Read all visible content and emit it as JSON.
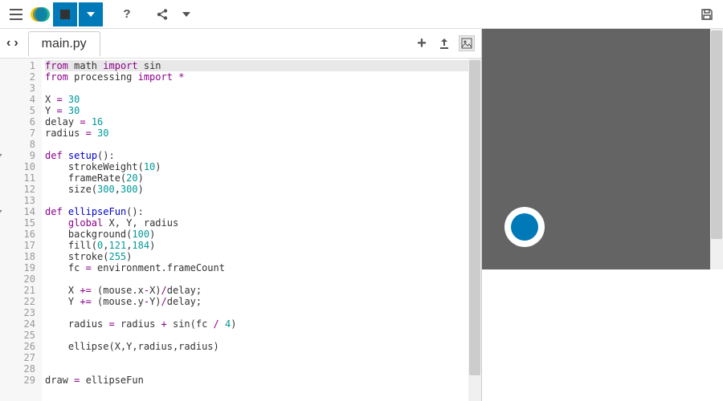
{
  "toolbar": {
    "menu": "menu",
    "help": "?",
    "share": "share",
    "dropdown": "▼",
    "save": "save"
  },
  "tabs": {
    "back": "‹",
    "forward": "›",
    "filename": "main.py",
    "add": "+",
    "upload": "⬆",
    "image": "img"
  },
  "code": {
    "lines": [
      {
        "n": 1,
        "fold": false,
        "tokens": [
          [
            "kw",
            "from"
          ],
          [
            "id",
            " math "
          ],
          [
            "kw",
            "import"
          ],
          [
            "id",
            " sin"
          ]
        ]
      },
      {
        "n": 2,
        "fold": false,
        "tokens": [
          [
            "kw",
            "from"
          ],
          [
            "id",
            " processing "
          ],
          [
            "kw",
            "import"
          ],
          [
            "id",
            " "
          ],
          [
            "op",
            "*"
          ]
        ]
      },
      {
        "n": 3,
        "fold": false,
        "tokens": []
      },
      {
        "n": 4,
        "fold": false,
        "tokens": [
          [
            "id",
            "X "
          ],
          [
            "op",
            "="
          ],
          [
            "id",
            " "
          ],
          [
            "num",
            "30"
          ]
        ]
      },
      {
        "n": 5,
        "fold": false,
        "tokens": [
          [
            "id",
            "Y "
          ],
          [
            "op",
            "="
          ],
          [
            "id",
            " "
          ],
          [
            "num",
            "30"
          ]
        ]
      },
      {
        "n": 6,
        "fold": false,
        "tokens": [
          [
            "id",
            "delay "
          ],
          [
            "op",
            "="
          ],
          [
            "id",
            " "
          ],
          [
            "num",
            "16"
          ]
        ]
      },
      {
        "n": 7,
        "fold": false,
        "tokens": [
          [
            "id",
            "radius "
          ],
          [
            "op",
            "="
          ],
          [
            "id",
            " "
          ],
          [
            "num",
            "30"
          ]
        ]
      },
      {
        "n": 8,
        "fold": false,
        "tokens": []
      },
      {
        "n": 9,
        "fold": true,
        "tokens": [
          [
            "kw",
            "def"
          ],
          [
            "id",
            " "
          ],
          [
            "fn",
            "setup"
          ],
          [
            "id",
            "():"
          ]
        ]
      },
      {
        "n": 10,
        "fold": false,
        "tokens": [
          [
            "id",
            "    strokeWeight("
          ],
          [
            "num",
            "10"
          ],
          [
            "id",
            ")"
          ]
        ]
      },
      {
        "n": 11,
        "fold": false,
        "tokens": [
          [
            "id",
            "    frameRate("
          ],
          [
            "num",
            "20"
          ],
          [
            "id",
            ")"
          ]
        ]
      },
      {
        "n": 12,
        "fold": false,
        "tokens": [
          [
            "id",
            "    size("
          ],
          [
            "num",
            "300"
          ],
          [
            "id",
            ","
          ],
          [
            "num",
            "300"
          ],
          [
            "id",
            ")"
          ]
        ]
      },
      {
        "n": 13,
        "fold": false,
        "tokens": []
      },
      {
        "n": 14,
        "fold": true,
        "tokens": [
          [
            "kw",
            "def"
          ],
          [
            "id",
            " "
          ],
          [
            "fn",
            "ellipseFun"
          ],
          [
            "id",
            "():"
          ]
        ]
      },
      {
        "n": 15,
        "fold": false,
        "tokens": [
          [
            "id",
            "    "
          ],
          [
            "kw",
            "global"
          ],
          [
            "id",
            " X, Y, radius"
          ]
        ]
      },
      {
        "n": 16,
        "fold": false,
        "tokens": [
          [
            "id",
            "    background("
          ],
          [
            "num",
            "100"
          ],
          [
            "id",
            ")"
          ]
        ]
      },
      {
        "n": 17,
        "fold": false,
        "tokens": [
          [
            "id",
            "    fill("
          ],
          [
            "num",
            "0"
          ],
          [
            "id",
            ","
          ],
          [
            "num",
            "121"
          ],
          [
            "id",
            ","
          ],
          [
            "num",
            "184"
          ],
          [
            "id",
            ")"
          ]
        ]
      },
      {
        "n": 18,
        "fold": false,
        "tokens": [
          [
            "id",
            "    stroke("
          ],
          [
            "num",
            "255"
          ],
          [
            "id",
            ")"
          ]
        ]
      },
      {
        "n": 19,
        "fold": false,
        "tokens": [
          [
            "id",
            "    fc "
          ],
          [
            "op",
            "="
          ],
          [
            "id",
            " environment.frameCount"
          ]
        ]
      },
      {
        "n": 20,
        "fold": false,
        "tokens": []
      },
      {
        "n": 21,
        "fold": false,
        "tokens": [
          [
            "id",
            "    X "
          ],
          [
            "op",
            "+="
          ],
          [
            "id",
            " (mouse.x"
          ],
          [
            "op",
            "-"
          ],
          [
            "id",
            "X)"
          ],
          [
            "op",
            "/"
          ],
          [
            "id",
            "delay;"
          ]
        ]
      },
      {
        "n": 22,
        "fold": false,
        "tokens": [
          [
            "id",
            "    Y "
          ],
          [
            "op",
            "+="
          ],
          [
            "id",
            " (mouse.y"
          ],
          [
            "op",
            "-"
          ],
          [
            "id",
            "Y)"
          ],
          [
            "op",
            "/"
          ],
          [
            "id",
            "delay;"
          ]
        ]
      },
      {
        "n": 23,
        "fold": false,
        "tokens": []
      },
      {
        "n": 24,
        "fold": false,
        "tokens": [
          [
            "id",
            "    radius "
          ],
          [
            "op",
            "="
          ],
          [
            "id",
            " radius "
          ],
          [
            "op",
            "+"
          ],
          [
            "id",
            " sin(fc "
          ],
          [
            "op",
            "/"
          ],
          [
            "id",
            " "
          ],
          [
            "num",
            "4"
          ],
          [
            "id",
            ")"
          ]
        ]
      },
      {
        "n": 25,
        "fold": false,
        "tokens": []
      },
      {
        "n": 26,
        "fold": false,
        "tokens": [
          [
            "id",
            "    ellipse(X,Y,radius,radius)"
          ]
        ]
      },
      {
        "n": 27,
        "fold": false,
        "tokens": []
      },
      {
        "n": 28,
        "fold": false,
        "tokens": []
      },
      {
        "n": 29,
        "fold": false,
        "tokens": [
          [
            "id",
            "draw "
          ],
          [
            "op",
            "="
          ],
          [
            "id",
            " ellipseFun"
          ]
        ]
      }
    ]
  },
  "canvas": {
    "bg": "#646464",
    "ellipse_fill": "#0079b8",
    "ellipse_stroke": "#ffffff"
  }
}
